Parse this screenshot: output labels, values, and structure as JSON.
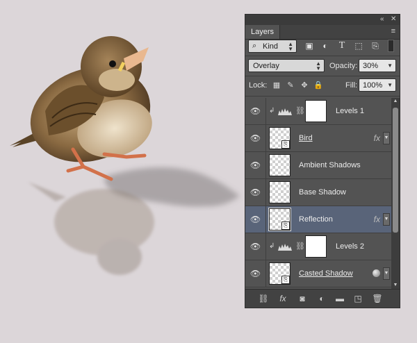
{
  "panel": {
    "tab_label": "Layers",
    "filter": {
      "kind_label": "Kind"
    },
    "blend": {
      "mode": "Overlay",
      "opacity_label": "Opacity:",
      "opacity_value": "30%"
    },
    "lock": {
      "label": "Lock:",
      "fill_label": "Fill:",
      "fill_value": "100%"
    },
    "layers": [
      {
        "name": "Levels 1",
        "type": "adjustment",
        "clipped": true
      },
      {
        "name": "Bird",
        "type": "smart",
        "underlined": true,
        "fx": true
      },
      {
        "name": "Ambient Shadows",
        "type": "pixel"
      },
      {
        "name": "Base Shadow",
        "type": "pixel"
      },
      {
        "name": "Reflection",
        "type": "smart",
        "fx": true,
        "selected": true
      },
      {
        "name": "Levels 2",
        "type": "adjustment",
        "clipped": true
      },
      {
        "name": "Casted Shadow",
        "type": "smart",
        "underlined": true,
        "style": true
      }
    ],
    "fx_label": "fx",
    "selection_color": "#596479"
  },
  "canvas": {
    "background": "#dcd6d9"
  }
}
